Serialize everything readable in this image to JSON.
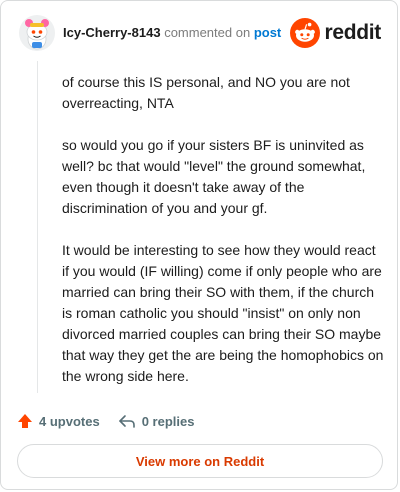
{
  "comment": {
    "username": "Icy-Cherry-8143",
    "action_text": "commented on",
    "post_link": "post",
    "paragraphs": [
      "of course this IS personal, and NO you are not overreacting, NTA",
      "so would you go if your sisters BF is uninvited as well? bc that would \"level\" the ground somewhat, even though it doesn't take away of the discrimination of you and your gf.",
      "It would be interesting to see how they would react if you would (IF willing) come if only people who are married can bring their SO with them, if the church is roman catholic you should \"insist\" on only non divorced married couples can bring their SO maybe that way they get the are being the homophobics on the wrong side here."
    ]
  },
  "brand": {
    "name": "reddit",
    "color": "#ff4500",
    "icon": "reddit-snoo-icon"
  },
  "actions": {
    "upvotes": "4 upvotes",
    "replies": "0 replies",
    "upvote_icon": "upvote-arrow-icon",
    "reply_icon": "reply-arrow-icon"
  },
  "footer": {
    "view_more": "View more on Reddit"
  },
  "colors": {
    "link": "#0079d3",
    "accent": "#d93a00",
    "upvote": "#ff4500"
  }
}
